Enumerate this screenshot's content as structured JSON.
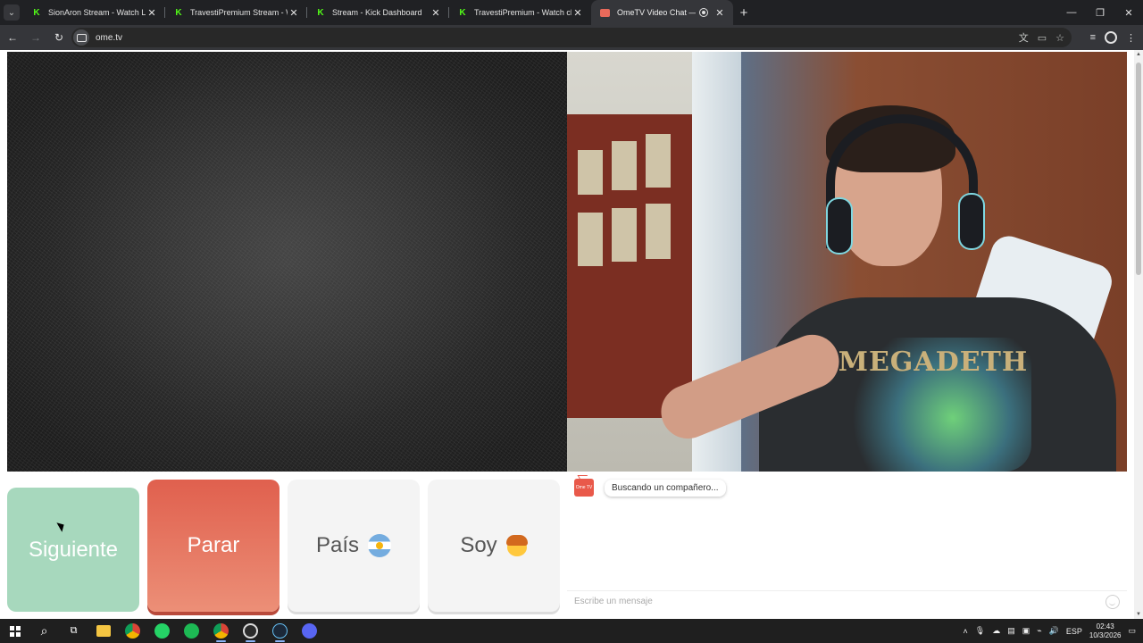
{
  "browser": {
    "tabs": [
      {
        "title": "SionAron Stream - Watch Live o",
        "favicon": "kick-icon",
        "active": false
      },
      {
        "title": "TravestiPremium Stream - Watc",
        "favicon": "kick-icon",
        "active": false
      },
      {
        "title": "Stream - Kick Dashboard",
        "favicon": "kick-icon",
        "active": false
      },
      {
        "title": "TravestiPremium - Watch clips o",
        "favicon": "kick-icon",
        "active": false
      },
      {
        "title": "OmeTV Video Chat — Ome",
        "favicon": "ometv-icon",
        "active": true,
        "recording": true
      }
    ],
    "url": "ome.tv",
    "accent": "#53fc18"
  },
  "page": {
    "remote_video": {
      "state": "static-noise"
    },
    "self_video": {
      "shirt_text": "MEGADETH"
    },
    "controls": {
      "next_label": "Siguiente",
      "stop_label": "Parar",
      "country_label": "País",
      "country_flag": "argentina-flag-icon",
      "gender_label": "Soy",
      "gender_icon": "boy-emoji-icon"
    },
    "chat": {
      "logo_text": "Ome TV",
      "status_message": "Buscando un compañero...",
      "input_placeholder": "Escribe un mensaje"
    },
    "colors": {
      "next_button": "#a7d8bd",
      "stop_button": "#e0604e",
      "neutral_button": "#f4f4f4"
    }
  },
  "taskbar": {
    "apps": [
      "windows-start-icon",
      "search-icon",
      "task-view-icon",
      "file-explorer-icon",
      "chrome-icon",
      "whatsapp-icon",
      "spotify-icon",
      "chrome-icon",
      "obs-icon",
      "steam-icon",
      "discord-icon"
    ],
    "tray": {
      "language": "ESP",
      "time": "02:43",
      "date": "10/3/2026"
    }
  }
}
